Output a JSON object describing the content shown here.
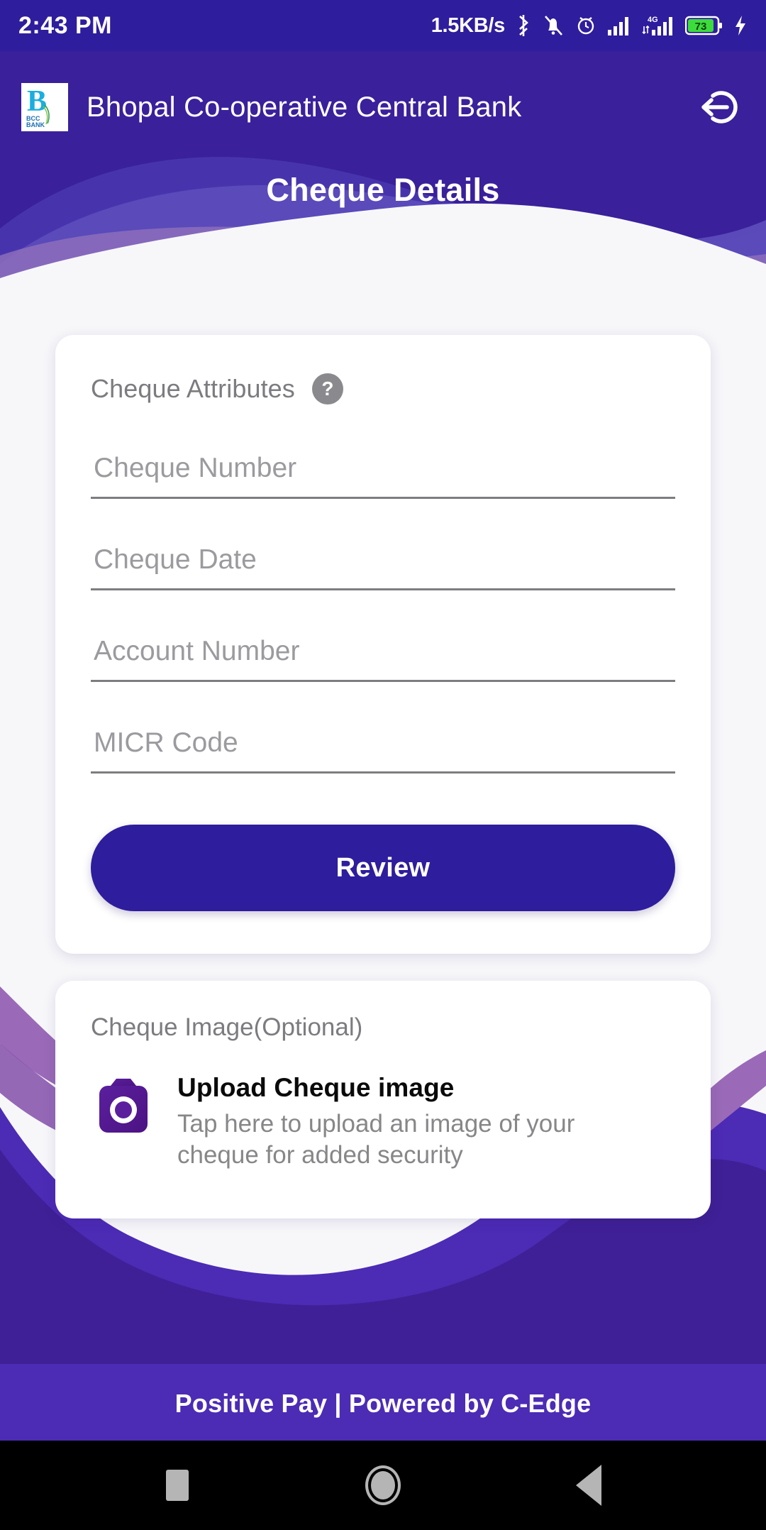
{
  "statusbar": {
    "time": "2:43 PM",
    "network_speed": "1.5KB/s",
    "battery_level": "73",
    "network_type": "4G",
    "icons": [
      "bluetooth-icon",
      "mute-bell-icon",
      "alarm-icon",
      "signal-icon",
      "signal-4g-icon",
      "battery-icon",
      "charging-bolt-icon"
    ]
  },
  "header": {
    "bank_name": "Bhopal Co-operative Central Bank",
    "logo_letter": "B",
    "logo_caption_line1": "BCC",
    "logo_caption_line2": "BANK",
    "page_title": "Cheque Details",
    "logout_label": "logout"
  },
  "attributes_card": {
    "section_title": "Cheque Attributes",
    "help_glyph": "?",
    "fields": [
      {
        "name": "cheque-number",
        "placeholder": "Cheque Number",
        "value": ""
      },
      {
        "name": "cheque-date",
        "placeholder": "Cheque Date",
        "value": ""
      },
      {
        "name": "account-number",
        "placeholder": "Account Number",
        "value": ""
      },
      {
        "name": "micr-code",
        "placeholder": "MICR Code",
        "value": ""
      }
    ],
    "review_label": "Review"
  },
  "image_card": {
    "title": "Cheque Image(Optional)",
    "upload_title": "Upload Cheque image",
    "upload_desc": "Tap here to upload an image of your cheque for added security"
  },
  "footer": {
    "text": "Positive Pay | Powered by C-Edge"
  },
  "navbar": {
    "recents_label": "recents",
    "home_label": "home",
    "back_label": "back"
  },
  "colors": {
    "status_bar": "#2e1d9c",
    "header_bg": "#3a209b",
    "primary": "#2e1d9c",
    "wave_light": "#6a5ac4",
    "wave_violet": "#8a6fc0",
    "wave_pink": "#9a6ab8",
    "camera_purple": "#5e1b91",
    "card_bg": "#ffffff",
    "placeholder": "#9b9b9f"
  }
}
